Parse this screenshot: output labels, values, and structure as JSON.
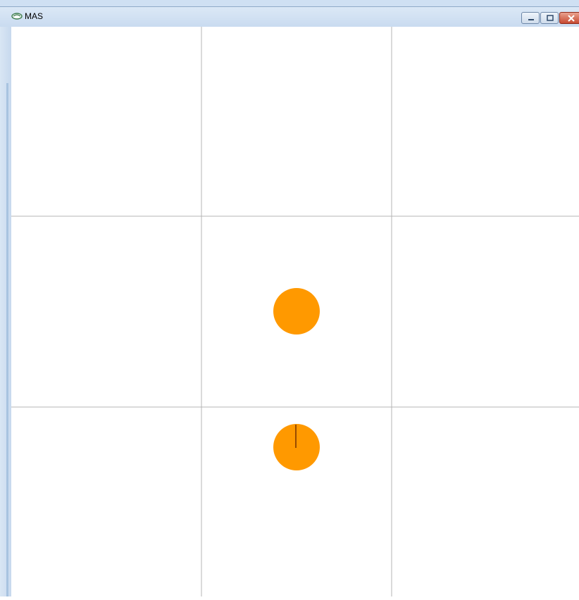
{
  "window": {
    "title": "MAS",
    "icon": "app-icon",
    "controls": [
      "minimize-icon",
      "maximize-icon",
      "close-icon"
    ]
  },
  "grid": {
    "rows": 3,
    "cols": 3,
    "line_color": "#b4b4b4",
    "background": "#ffffff"
  },
  "agents": [
    {
      "cell_row": 1,
      "cell_col": 1,
      "color": "#ff9900",
      "heading_line": false
    },
    {
      "cell_row": 2,
      "cell_col": 1,
      "color": "#ff9900",
      "heading_line": true,
      "heading_color": "#6b2a00"
    }
  ]
}
